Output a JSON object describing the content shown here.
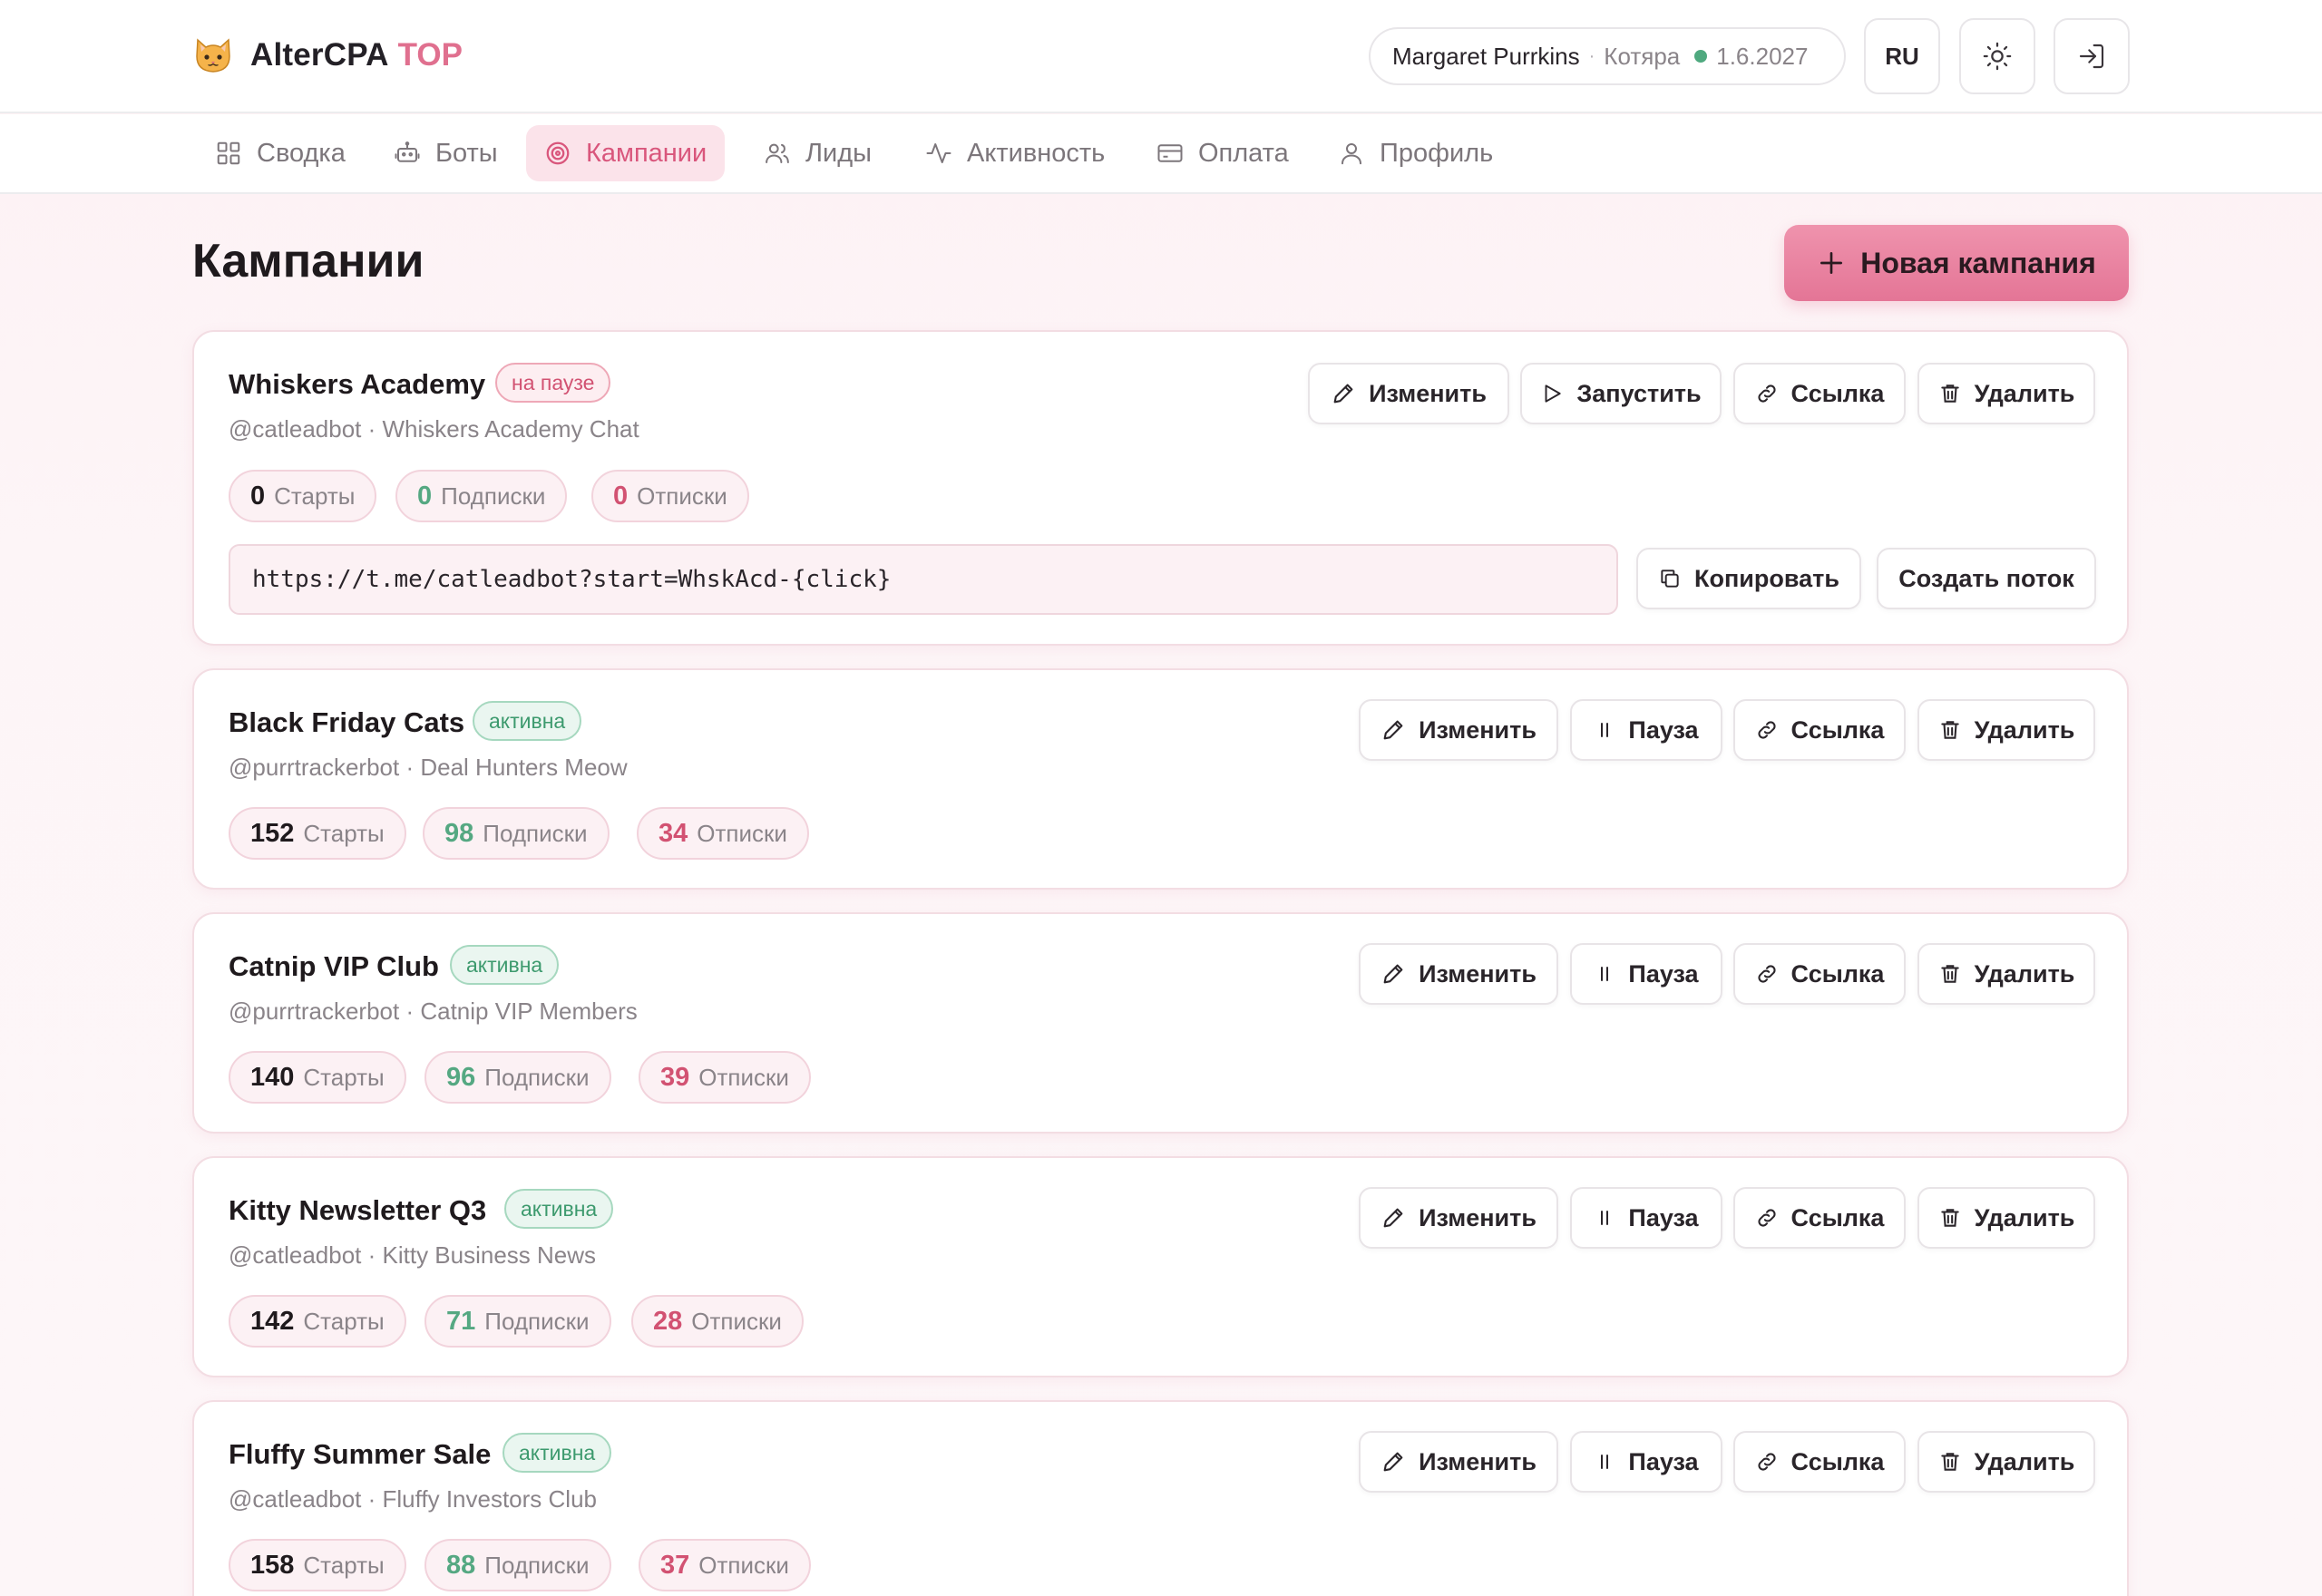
{
  "app": {
    "name": "AlterCPA",
    "tier": "TOP"
  },
  "user": {
    "name": "Margaret Purrkins",
    "separator": "·",
    "role": "Котяра",
    "expires": "1.6.2027"
  },
  "header": {
    "lang": "RU"
  },
  "nav": [
    {
      "label": "Сводка",
      "icon": "grid-icon"
    },
    {
      "label": "Боты",
      "icon": "bot-icon"
    },
    {
      "label": "Кампании",
      "icon": "target-icon",
      "active": true
    },
    {
      "label": "Лиды",
      "icon": "users-icon"
    },
    {
      "label": "Активность",
      "icon": "activity-icon"
    },
    {
      "label": "Оплата",
      "icon": "card-icon"
    },
    {
      "label": "Профиль",
      "icon": "user-icon"
    }
  ],
  "page": {
    "title": "Кампании",
    "new_button": "Новая кампания"
  },
  "labels": {
    "edit": "Изменить",
    "start": "Запустить",
    "pause": "Пауза",
    "link": "Ссылка",
    "delete": "Удалить",
    "copy": "Копировать",
    "create_flow": "Создать поток",
    "starts": "Старты",
    "subs": "Подписки",
    "unsubs": "Отписки",
    "status_paused": "на паузе",
    "status_active": "активна"
  },
  "colors": {
    "accent": "#e47596",
    "active_green": "#3d9a6e",
    "paused_red": "#d25272"
  },
  "campaigns": [
    {
      "name": "Whiskers Academy",
      "status": "на паузе",
      "bot": "@catleadbot",
      "channel": "Whiskers Academy Chat",
      "starts": "0",
      "subs": "0",
      "unsubs": "0",
      "url": "https://t.me/catleadbot?start=WhskAcd-{click}"
    },
    {
      "name": "Black Friday Cats",
      "status": "активна",
      "bot": "@purrtrackerbot",
      "channel": "Deal Hunters Meow",
      "starts": "152",
      "subs": "98",
      "unsubs": "34"
    },
    {
      "name": "Catnip VIP Club",
      "status": "активна",
      "bot": "@purrtrackerbot",
      "channel": "Catnip VIP Members",
      "starts": "140",
      "subs": "96",
      "unsubs": "39"
    },
    {
      "name": "Kitty Newsletter Q3",
      "status": "активна",
      "bot": "@catleadbot",
      "channel": "Kitty Business News",
      "starts": "142",
      "subs": "71",
      "unsubs": "28"
    },
    {
      "name": "Fluffy Summer Sale",
      "status": "активна",
      "bot": "@catleadbot",
      "channel": "Fluffy Investors Club",
      "starts": "158",
      "subs": "88",
      "unsubs": "37"
    }
  ],
  "subtitle_sep": " · "
}
